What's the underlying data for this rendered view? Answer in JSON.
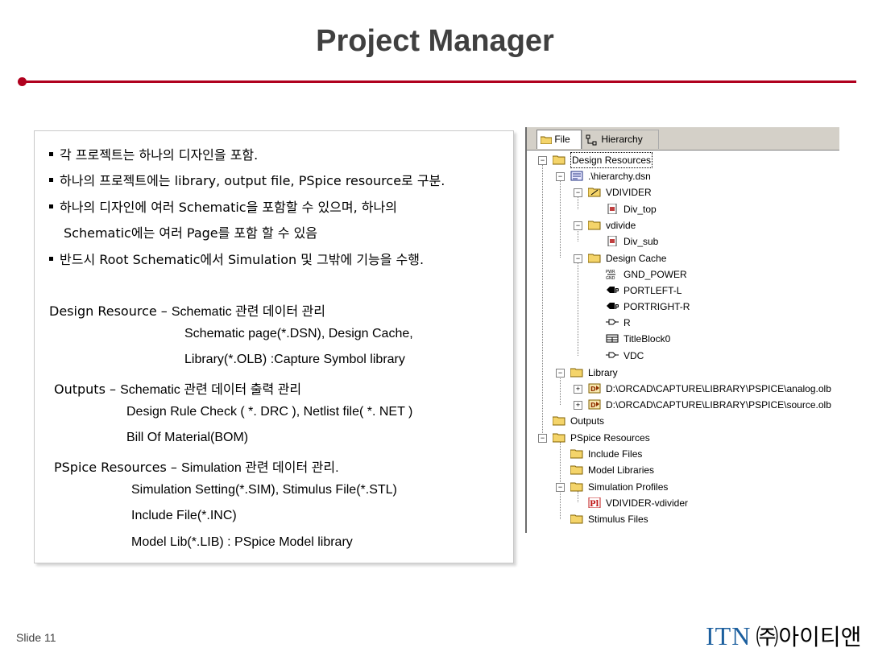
{
  "slide": {
    "title": "Project Manager",
    "number": "Slide 11",
    "logo_itn": "ITN",
    "logo_korean": "㈜아이티앤"
  },
  "bullets": [
    "각 프로젝트는 하나의 디자인을 포함.",
    "하나의 프로젝트에는 library, output file, PSpice resource로 구분.",
    "하나의 디자인에 여러 Schematic을 포함할 수 있으며, 하나의",
    "Schematic에는 여러 Page를 포함 할 수 있음",
    "반드시 Root Schematic에서 Simulation 및 그밖에 기능을 수행."
  ],
  "descriptions": {
    "design_label": "Design Resource – ",
    "design_text": "Schematic 관련 데이터 관리",
    "design_line2": "Schematic page(*.DSN), Design Cache,",
    "design_line3": "Library(*.OLB) :Capture Symbol library",
    "outputs_label": "Outputs – ",
    "outputs_text": "Schematic 관련 데이터 출력 관리",
    "outputs_line2": "Design Rule Check ( *. DRC ), Netlist file( *. NET )",
    "outputs_line3": "Bill Of Material(BOM)",
    "pspice_label": "PSpice Resources – ",
    "pspice_text": "Simulation 관련 데이터 관리.",
    "pspice_line2": "Simulation Setting(*.SIM), Stimulus File(*.STL)",
    "pspice_line3": "Include File(*.INC)",
    "pspice_line4": "Model Lib(*.LIB) : PSpice Model library"
  },
  "tree": {
    "tabs": [
      "File",
      "Hierarchy"
    ],
    "nodes": [
      {
        "label": "Design Resources",
        "icon": "folder-open-icon"
      },
      {
        "label": ".\\hierarchy.dsn",
        "icon": "design-icon"
      },
      {
        "label": "VDIVIDER",
        "icon": "root-schematic-folder-icon"
      },
      {
        "label": "Div_top",
        "icon": "page-icon"
      },
      {
        "label": "vdivide",
        "icon": "folder-open-icon"
      },
      {
        "label": "Div_sub",
        "icon": "page-icon"
      },
      {
        "label": "Design Cache",
        "icon": "folder-open-icon"
      },
      {
        "label": "GND_POWER",
        "icon": "power-symbol-icon"
      },
      {
        "label": "PORTLEFT-L",
        "icon": "port-icon"
      },
      {
        "label": "PORTRIGHT-R",
        "icon": "port-icon"
      },
      {
        "label": "R",
        "icon": "part-icon"
      },
      {
        "label": "TitleBlock0",
        "icon": "titleblock-icon"
      },
      {
        "label": "VDC",
        "icon": "part-icon"
      },
      {
        "label": "Library",
        "icon": "folder-open-icon"
      },
      {
        "label": "D:\\ORCAD\\CAPTURE\\LIBRARY\\PSPICE\\analog.olb",
        "icon": "library-icon"
      },
      {
        "label": "D:\\ORCAD\\CAPTURE\\LIBRARY\\PSPICE\\source.olb",
        "icon": "library-icon"
      },
      {
        "label": "Outputs",
        "icon": "folder-icon"
      },
      {
        "label": "PSpice Resources",
        "icon": "folder-open-icon"
      },
      {
        "label": "Include Files",
        "icon": "folder-icon"
      },
      {
        "label": "Model Libraries",
        "icon": "folder-icon"
      },
      {
        "label": "Simulation Profiles",
        "icon": "folder-open-icon"
      },
      {
        "label": "VDIVIDER-vdivider",
        "icon": "sim-profile-icon"
      },
      {
        "label": "Stimulus Files",
        "icon": "folder-icon"
      }
    ]
  },
  "colors": {
    "accent_rule": "#b0001e",
    "title": "#404040",
    "logo_blue": "#1c5f9e",
    "folder_yellow": "#f4d46a",
    "sim_red": "#c01818"
  }
}
